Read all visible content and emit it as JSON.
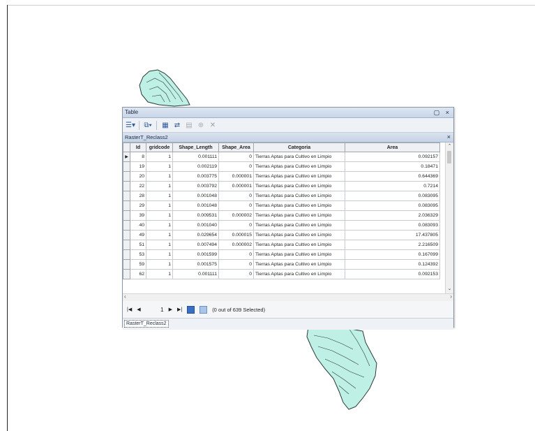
{
  "window": {
    "title": "Table",
    "restore_glyph": "▢",
    "close_glyph": "×"
  },
  "toolbar": {
    "table_options_icon": "table-options-icon",
    "related_tables_icon": "related-tables-icon",
    "select_by_attributes_icon": "select-by-attributes-icon",
    "switch_selection_icon": "switch-selection-icon",
    "clear_selection_icon": "clear-selection-icon",
    "zoom_to_selected_icon": "zoom-to-selected-icon",
    "delete_selected_icon": "delete-selected-icon"
  },
  "table_tab": {
    "name": "RasterT_Reclass2",
    "close_glyph": "×"
  },
  "columns": [
    "Id",
    "gridcode",
    "Shape_Length",
    "Shape_Area",
    "Categoria",
    "Area"
  ],
  "rows": [
    {
      "id": "8",
      "gridcode": "1",
      "shape_length": "0.001111",
      "shape_area": "0",
      "categoria": "Tierras Aptas para Cultivo en Limpio",
      "area": "0.092157"
    },
    {
      "id": "19",
      "gridcode": "1",
      "shape_length": "0.002119",
      "shape_area": "0",
      "categoria": "Tierras Aptas para Cultivo en Limpio",
      "area": "0.18471"
    },
    {
      "id": "20",
      "gridcode": "1",
      "shape_length": "0.003775",
      "shape_area": "0.000001",
      "categoria": "Tierras Aptas para Cultivo en Limpio",
      "area": "0.644369"
    },
    {
      "id": "22",
      "gridcode": "1",
      "shape_length": "0.003792",
      "shape_area": "0.000001",
      "categoria": "Tierras Aptas para Cultivo en Limpio",
      "area": "0.7214"
    },
    {
      "id": "28",
      "gridcode": "1",
      "shape_length": "0.001048",
      "shape_area": "0",
      "categoria": "Tierras Aptas para Cultivo en Limpio",
      "area": "0.083095"
    },
    {
      "id": "29",
      "gridcode": "1",
      "shape_length": "0.001048",
      "shape_area": "0",
      "categoria": "Tierras Aptas para Cultivo en Limpio",
      "area": "0.083095"
    },
    {
      "id": "39",
      "gridcode": "1",
      "shape_length": "0.009531",
      "shape_area": "0.000002",
      "categoria": "Tierras Aptas para Cultivo en Limpio",
      "area": "2.036329"
    },
    {
      "id": "40",
      "gridcode": "1",
      "shape_length": "0.001040",
      "shape_area": "0",
      "categoria": "Tierras Aptas para Cultivo en Limpio",
      "area": "0.083093"
    },
    {
      "id": "49",
      "gridcode": "1",
      "shape_length": "0.029654",
      "shape_area": "0.000015",
      "categoria": "Tierras Aptas para Cultivo en Limpio",
      "area": "17.437805"
    },
    {
      "id": "51",
      "gridcode": "1",
      "shape_length": "0.007494",
      "shape_area": "0.000002",
      "categoria": "Tierras Aptas para Cultivo en Limpio",
      "area": "2.216509"
    },
    {
      "id": "53",
      "gridcode": "1",
      "shape_length": "0.001599",
      "shape_area": "0",
      "categoria": "Tierras Aptas para Cultivo en Limpio",
      "area": "0.167099"
    },
    {
      "id": "59",
      "gridcode": "1",
      "shape_length": "0.001575",
      "shape_area": "0",
      "categoria": "Tierras Aptas para Cultivo en Limpio",
      "area": "0.124392"
    },
    {
      "id": "62",
      "gridcode": "1",
      "shape_length": "0.001111",
      "shape_area": "0",
      "categoria": "Tierras Aptas para Cultivo en Limpio",
      "area": "0.092153"
    }
  ],
  "current_row_marker": "▶",
  "navigation": {
    "first": "|◀",
    "prev": "◀",
    "current_record": "1",
    "next": "▶",
    "last": "▶|",
    "selection_status": "(0 out of 639 Selected)"
  },
  "bottom_tab": {
    "label": "RasterT_Reclass2"
  },
  "colors": {
    "map_fill": "#bff0e6",
    "map_stroke": "#2b3a3a"
  }
}
